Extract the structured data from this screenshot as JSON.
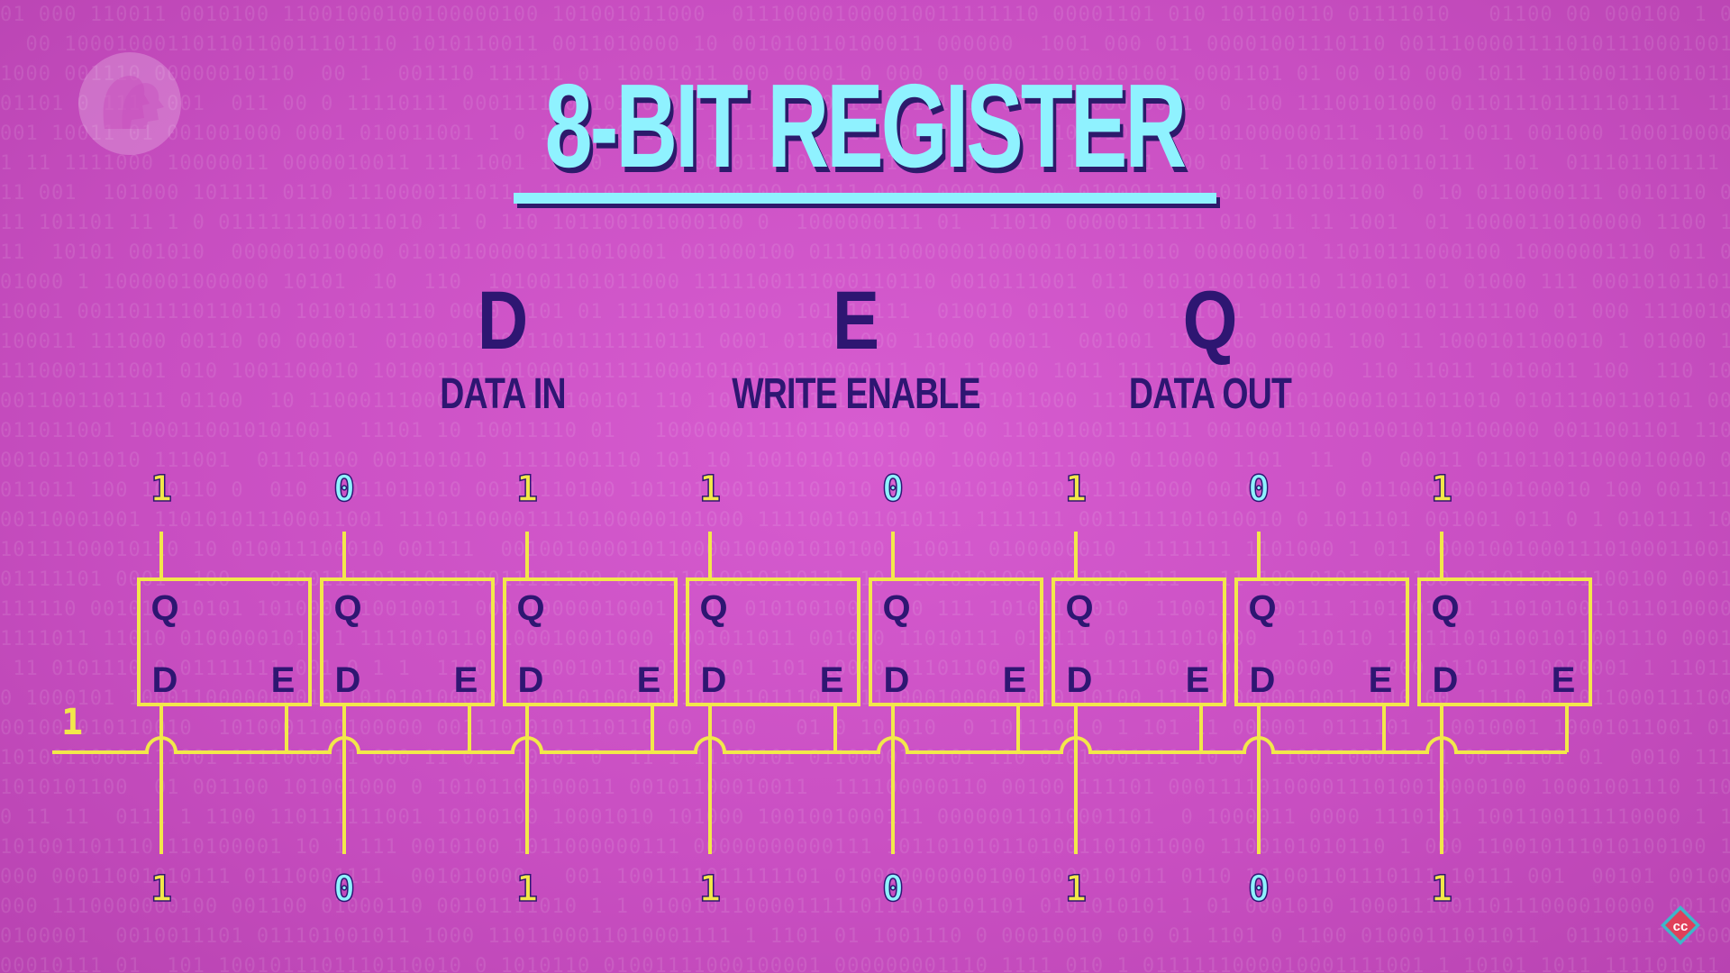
{
  "title": "8-BIT REGISTER",
  "legend": [
    {
      "letter": "D",
      "label": "DATA IN"
    },
    {
      "letter": "E",
      "label": "WRITE ENABLE"
    },
    {
      "letter": "Q",
      "label": "DATA OUT"
    }
  ],
  "enable_value": "1",
  "latch_labels": {
    "q": "Q",
    "d": "D",
    "e": "E"
  },
  "outputs_top": [
    "1",
    "0",
    "1",
    "1",
    "0",
    "1",
    "0",
    "1"
  ],
  "inputs_bottom": [
    "1",
    "0",
    "1",
    "1",
    "0",
    "1",
    "0",
    "1"
  ],
  "colors": {
    "wire": "#f2e84a",
    "one_digit": "#f2e84a",
    "zero_digit": "#8ff2ff",
    "title": "#8ff2ff",
    "text_dark": "#2e1672",
    "background": "#d05ac9"
  },
  "logos": [
    "pbs-logo-icon",
    "crash-course-logo-icon"
  ]
}
